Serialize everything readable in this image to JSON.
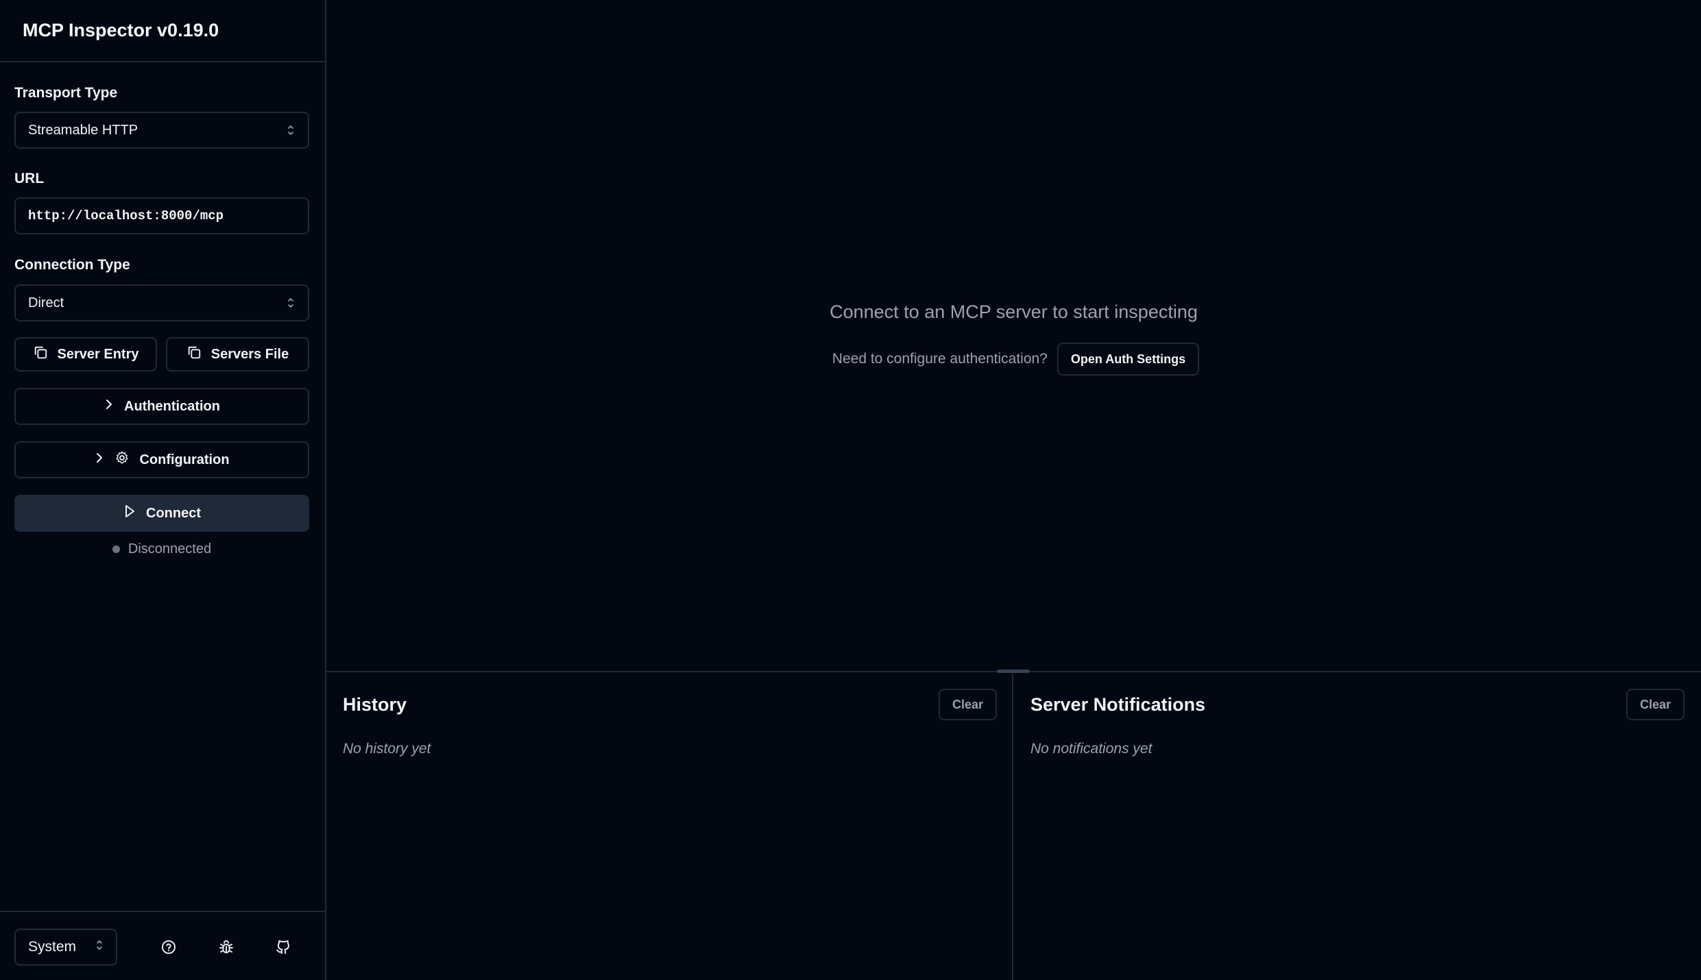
{
  "app": {
    "title": "MCP Inspector v0.19.0"
  },
  "sidebar": {
    "transport": {
      "label": "Transport Type",
      "value": "Streamable HTTP"
    },
    "url": {
      "label": "URL",
      "value": "http://localhost:8000/mcp"
    },
    "connection": {
      "label": "Connection Type",
      "value": "Direct"
    },
    "buttons": {
      "server_entry": "Server Entry",
      "servers_file": "Servers File",
      "authentication": "Authentication",
      "configuration": "Configuration",
      "connect": "Connect"
    },
    "status": {
      "text": "Disconnected",
      "color": "#6b7280"
    },
    "footer": {
      "theme": "System",
      "icons": [
        "help-icon",
        "bug-icon",
        "github-icon"
      ]
    }
  },
  "main": {
    "prompt": "Connect to an MCP server to start inspecting",
    "auth_question": "Need to configure authentication?",
    "auth_button": "Open Auth Settings"
  },
  "history": {
    "title": "History",
    "clear": "Clear",
    "empty": "No history yet"
  },
  "notifications": {
    "title": "Server Notifications",
    "clear": "Clear",
    "empty": "No notifications yet"
  },
  "colors": {
    "background": "#030712",
    "border": "#1f2937",
    "muted": "#9ca3af",
    "connect_bg": "#1f2937"
  }
}
